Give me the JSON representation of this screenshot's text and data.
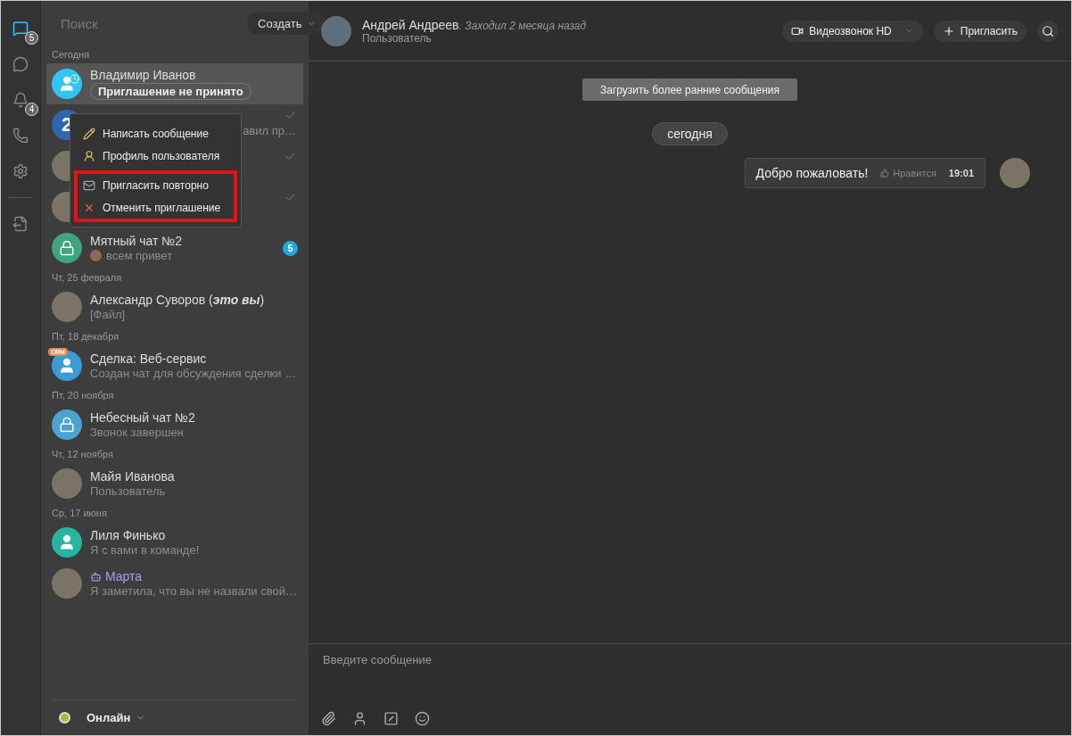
{
  "rail": [
    {
      "kind": "chats",
      "selected": true,
      "badge": "5"
    },
    {
      "kind": "channels",
      "selected": false
    },
    {
      "kind": "notifications",
      "selected": false,
      "badge": "4"
    },
    {
      "kind": "calls",
      "selected": false
    },
    {
      "kind": "settings",
      "selected": false
    },
    {
      "kind": "divider"
    },
    {
      "kind": "export",
      "selected": false
    }
  ],
  "search": {
    "placeholder": "Поиск"
  },
  "create_button": "Создать",
  "chat_groups": [
    {
      "date": "Сегодня",
      "chats": [
        {
          "kind": "invite",
          "avatar": {
            "kind": "user",
            "color": "#2fc6f6"
          },
          "name": "Владимир Иванов",
          "status": "Приглашение не принято",
          "selected": true
        },
        {
          "kind": "covered",
          "avatar": {
            "kind": "number",
            "color": "#2c67b0",
            "text": "2"
          },
          "preview": "авил пр…",
          "read": true
        },
        {
          "kind": "covered",
          "avatar": {
            "kind": "photo"
          },
          "read": true
        },
        {
          "kind": "covered",
          "avatar": {
            "kind": "photo"
          },
          "read": true
        },
        {
          "kind": "chat",
          "avatar": {
            "kind": "lock",
            "color": "#3fa57e"
          },
          "name": "Мятный чат №2",
          "preview": "всем привет",
          "preview_avatar": true,
          "badge": "5",
          "selected": false
        }
      ]
    },
    {
      "date": "Чт, 25 февраля",
      "chats": [
        {
          "kind": "chat",
          "avatar": {
            "kind": "photo"
          },
          "name": "Александр Суворов (**это вы**)",
          "preview": "[Файл]",
          "selected": false
        }
      ]
    },
    {
      "date": "Пт, 18 декабря",
      "chats": [
        {
          "kind": "chat",
          "avatar": {
            "kind": "user",
            "color": "#3a9bd5"
          },
          "tag": "CRM",
          "name": "Сделка: Веб-сервис",
          "preview": "Создан чат для обсуждения сделки …",
          "selected": false
        }
      ]
    },
    {
      "date": "Пт, 20 ноября",
      "chats": [
        {
          "kind": "chat",
          "avatar": {
            "kind": "lock",
            "color": "#4aa3d0"
          },
          "name": "Небесный чат №2",
          "preview": "Звонок завершен",
          "selected": false
        }
      ]
    },
    {
      "date": "Чт, 12 ноября",
      "chats": [
        {
          "kind": "chat",
          "avatar": {
            "kind": "photo"
          },
          "name": "Майя Иванова",
          "preview": "Пользователь",
          "selected": false
        }
      ]
    },
    {
      "date": "Ср, 17 июня",
      "chats": [
        {
          "kind": "chat",
          "avatar": {
            "kind": "user",
            "color": "#26b5a0"
          },
          "name": "Лиля Финько",
          "preview": "Я с вами в команде!",
          "selected": false
        },
        {
          "kind": "bot",
          "avatar": {
            "kind": "photo"
          },
          "name": "Марта",
          "preview": "Я заметила, что вы не назвали свой…",
          "selected": false
        }
      ]
    }
  ],
  "context_menu": {
    "sections": [
      {
        "highlighted": false,
        "items": [
          {
            "kind": "write",
            "label": "Написать сообщение"
          },
          {
            "kind": "profile",
            "label": "Профиль пользователя"
          }
        ]
      },
      {
        "highlighted": true,
        "items": [
          {
            "kind": "reinvite",
            "label": "Пригласить повторно"
          },
          {
            "kind": "cancel",
            "label": "Отменить приглашение"
          }
        ]
      }
    ]
  },
  "presence": {
    "label": "Онлайн",
    "color": "#9cc43b"
  },
  "header": {
    "name": "Андрей Андреев",
    "last_seen": ". Заходил 2 месяца назад",
    "role": "Пользователь",
    "buttons": [
      {
        "kind": "video",
        "label": "Видеозвонок HD"
      },
      {
        "kind": "invite",
        "label": "Пригласить"
      },
      {
        "kind": "search"
      }
    ]
  },
  "load_more": "Загрузить более ранние сообщения",
  "day": "сегодня",
  "messages": [
    {
      "text": "Добро пожаловать!",
      "like": "Нравится",
      "time": "19:01"
    }
  ],
  "composer": {
    "placeholder": "Введите сообщение",
    "tools": [
      {
        "kind": "attach"
      },
      {
        "kind": "mention"
      },
      {
        "kind": "command"
      },
      {
        "kind": "emoji"
      }
    ]
  }
}
